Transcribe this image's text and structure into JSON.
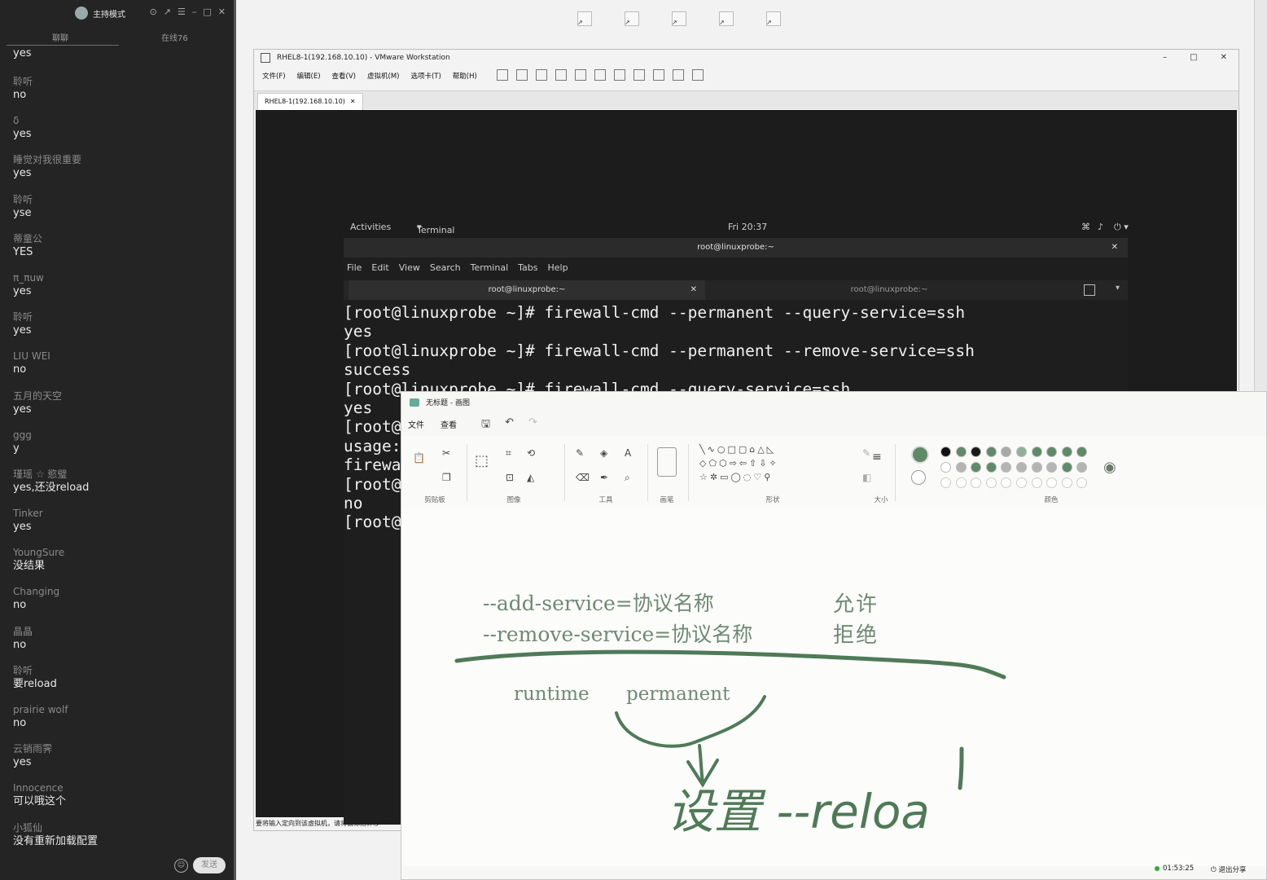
{
  "chat": {
    "mode_label": "主持模式",
    "tab_chat": "聊聊",
    "tab_online": "在线76",
    "send_label": "发送",
    "messages": [
      {
        "user": "",
        "text": "yes"
      },
      {
        "user": "聆听",
        "text": "no"
      },
      {
        "user": "δ",
        "text": "yes"
      },
      {
        "user": "睡觉对我很重要",
        "text": "yes"
      },
      {
        "user": "聆听",
        "text": "yse"
      },
      {
        "user": "蒂童公",
        "text": "YES"
      },
      {
        "user": "π_πuw",
        "text": "yes"
      },
      {
        "user": "聆听",
        "text": "yes"
      },
      {
        "user": "LIU WEI",
        "text": "no"
      },
      {
        "user": "五月的天空",
        "text": "yes"
      },
      {
        "user": "ggg",
        "text": "y"
      },
      {
        "user": "瑾瑶 ☆ 慾璧",
        "text": "yes,还没reload"
      },
      {
        "user": "Tinker",
        "text": "yes"
      },
      {
        "user": "YoungSure",
        "text": "没结果"
      },
      {
        "user": "Changing",
        "text": "no"
      },
      {
        "user": "晶晶",
        "text": "no"
      },
      {
        "user": "聆听",
        "text": "要reload"
      },
      {
        "user": "prairie wolf",
        "text": "no"
      },
      {
        "user": "云销雨霁",
        "text": "yes"
      },
      {
        "user": "Innocence",
        "text": "可以哦这个"
      },
      {
        "user": "小狐仙",
        "text": "没有重新加载配置"
      }
    ]
  },
  "vmware": {
    "title": "RHEL8-1(192.168.10.10) - VMware Workstation",
    "menu": [
      "文件(F)",
      "编辑(E)",
      "查看(V)",
      "虚拟机(M)",
      "选项卡(T)",
      "帮助(H)"
    ],
    "tab": "RHEL8-1(192.168.10.10)",
    "status": "要将输入定向到该虚拟机，请将鼠标指针移"
  },
  "gnome": {
    "activities": "Activities",
    "app": "Terminal",
    "clock": "Fri 20:37"
  },
  "terminal": {
    "window_title": "root@linuxprobe:~",
    "menu": [
      "File",
      "Edit",
      "View",
      "Search",
      "Terminal",
      "Tabs",
      "Help"
    ],
    "tab1": "root@linuxprobe:~",
    "tab2": "root@linuxprobe:~",
    "lines": [
      "[root@linuxprobe ~]# firewall-cmd --permanent --query-service=ssh",
      "yes",
      "[root@linuxprobe ~]# firewall-cmd --permanent --remove-service=ssh",
      "success",
      "[root@linuxprobe ~]# firewall-cmd --query-service=ssh",
      "yes",
      "[root@",
      "usage:",
      "firewa",
      "[root@",
      "no",
      "[root@"
    ]
  },
  "paint": {
    "title": "无标题 - 画图",
    "menu_file": "文件",
    "menu_view": "查看",
    "groups": {
      "clipboard": "剪贴板",
      "image": "图像",
      "tools": "工具",
      "brushes": "画笔",
      "shapes": "形状",
      "size": "大小",
      "colors": "颜色"
    },
    "palette": {
      "primary": "#5e8a68",
      "row1": [
        "#111111",
        "#5e8a68",
        "#1a1a1a",
        "#5e8a68",
        "#a8a8a8",
        "#8fb097",
        "#5e8a68",
        "#5e8a68",
        "#5e8a68",
        "#5e8a68"
      ],
      "row2": [
        "#ffffff",
        "#b4b4b4",
        "#5e8a68",
        "#5e8a68",
        "#b4b4b4",
        "#b4b4b4",
        "#b4b4b4",
        "#b4b4b4",
        "#5e8a68",
        "#b4b4b4"
      ]
    },
    "canvas": {
      "add_service": "--add-service=协议名称",
      "remove_service": "--remove-service=协议名称",
      "allow": "允许",
      "deny": "拒绝",
      "runtime": "runtime",
      "permanent": "permanent",
      "handwritten": "设置 --reloa"
    },
    "time": "01:53:25",
    "share": "退出分享"
  }
}
